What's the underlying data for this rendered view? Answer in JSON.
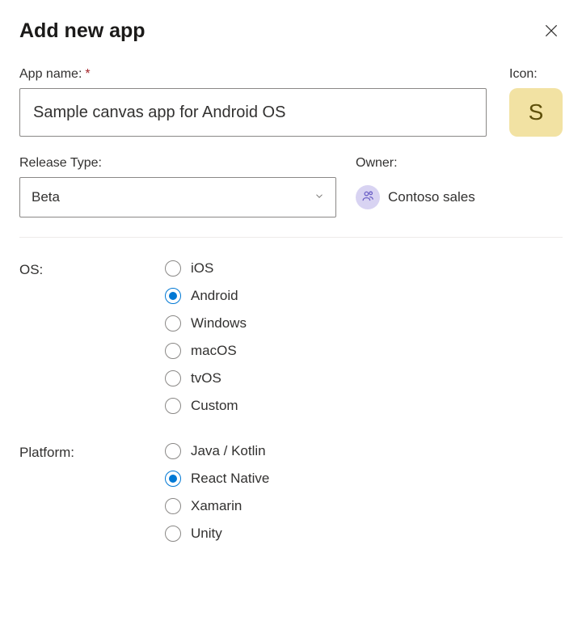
{
  "header": {
    "title": "Add new app"
  },
  "appName": {
    "label": "App name:",
    "required": "*",
    "value": "Sample canvas app for Android OS"
  },
  "icon": {
    "label": "Icon:",
    "letter": "S"
  },
  "releaseType": {
    "label": "Release Type:",
    "value": "Beta"
  },
  "owner": {
    "label": "Owner:",
    "name": "Contoso sales"
  },
  "os": {
    "label": "OS:",
    "selected": "Android",
    "options": [
      "iOS",
      "Android",
      "Windows",
      "macOS",
      "tvOS",
      "Custom"
    ]
  },
  "platform": {
    "label": "Platform:",
    "selected": "React Native",
    "options": [
      "Java / Kotlin",
      "React Native",
      "Xamarin",
      "Unity"
    ]
  }
}
